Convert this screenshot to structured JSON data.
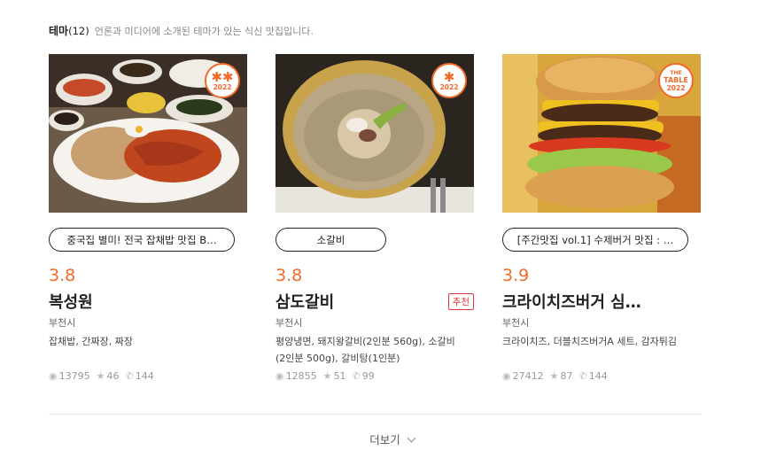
{
  "header": {
    "title": "테마",
    "count": "(12)",
    "description": "언론과 미디어에 소개된 테마가 있는 식신 맛집입니다."
  },
  "cards": [
    {
      "badge_symbol": "✱✱",
      "badge_year": "2022",
      "tag": "중국집 별미! 전국 잡채밥 맛집 B…",
      "rating": "3.8",
      "name": "복성원",
      "recommend": "",
      "location": "부천시",
      "menu": "잡채밥, 간짜장, 짜장",
      "views": "13795",
      "stars": "46",
      "calls": "144",
      "colors": {
        "bg": "#5a4a3a",
        "plate": "#f4f0ea",
        "food": "#c0461e"
      }
    },
    {
      "badge_symbol": "✱",
      "badge_year": "2022",
      "tag": "소갈비",
      "rating": "3.8",
      "name": "삼도갈비",
      "recommend": "추천",
      "location": "부천시",
      "menu": "평양냉면, 돼지왕갈비(2인분 560g), 소갈비(2인분 500g), 갈비탕(1인분)",
      "views": "12855",
      "stars": "51",
      "calls": "99",
      "colors": {
        "bg": "#2d2620",
        "plate": "#c9a24c",
        "food": "#b3a27a"
      }
    },
    {
      "badge_top": "THE",
      "badge_symbol": "TABLE",
      "badge_year": "2022",
      "tag": "[주간맛집 vol.1] 수제버거 맛집 : …",
      "rating": "3.9",
      "name": "크라이치즈버거 심…",
      "recommend": "",
      "location": "부천시",
      "menu": "크라이치즈, 더블치즈버거A 세트, 감자튀김",
      "views": "27412",
      "stars": "87",
      "calls": "144",
      "colors": {
        "bg": "#e8b23a",
        "plate": "#c9702a",
        "food": "#4a2a18"
      }
    }
  ],
  "more": {
    "label": "더보기"
  },
  "accent": "#f06a2a"
}
